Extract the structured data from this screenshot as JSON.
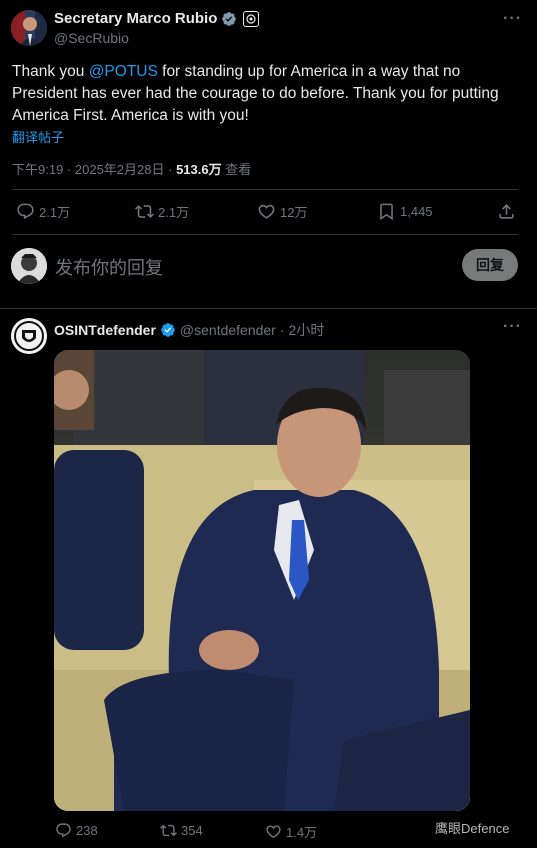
{
  "tweet": {
    "author_name": "Secretary Marco Rubio",
    "author_handle": "@SecRubio",
    "text_before": "Thank you ",
    "mention": "@POTUS",
    "text_after": " for standing up for America in a way that no President has ever had the courage to do before. Thank you for putting America First. America is with you!",
    "translate_label": "翻译帖子",
    "time": "下午9:19",
    "sep1": " · ",
    "date": "2025年2月28日",
    "sep2": " · ",
    "views": "513.6万",
    "views_label": " 查看",
    "replies": "2.1万",
    "reposts": "2.1万",
    "likes": "12万",
    "bookmarks": "1,445"
  },
  "compose": {
    "placeholder": "发布你的回复",
    "reply_button": "回复"
  },
  "reply_tweet": {
    "author_name": "OSINTdefender",
    "author_handle": "@sentdefender",
    "separator": " · ",
    "time_ago": "2小时",
    "replies": "238",
    "reposts": "354",
    "likes": "1.4万"
  },
  "watermark": "鹰眼Defence",
  "colors": {
    "background": "#000000",
    "text": "#e7e9ea",
    "muted": "#71767b",
    "accent": "#1d9bf0",
    "divider": "#2f3336"
  },
  "icons": [
    "more-icon",
    "verified-icon",
    "affiliate-badge-icon",
    "reply-icon",
    "repost-icon",
    "like-icon",
    "bookmark-icon",
    "share-icon"
  ]
}
